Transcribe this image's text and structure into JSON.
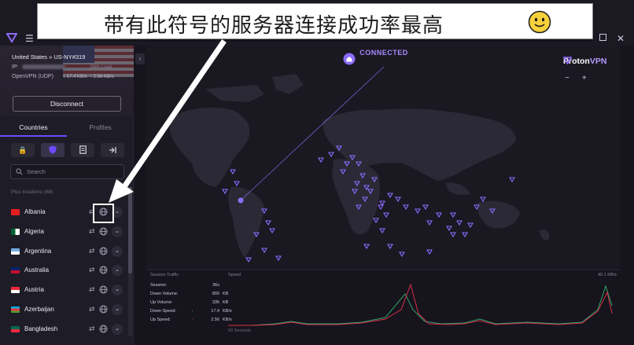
{
  "window": {
    "menu_icon": "hamburger-icon",
    "maximize_icon": "maximize-icon",
    "close_label": "✕"
  },
  "banner": {
    "text": "带有此符号的服务器连接成功率最高",
    "emoji_icon": "smiley-face-icon"
  },
  "connection": {
    "location": "United States » US-NY#319",
    "ip_label": "IP:",
    "load": "59% Load",
    "protocol": "OpenVPN (UDP)",
    "down": "↓ 17.4 KB/s",
    "up": "↑ 2.56 KB/s",
    "disconnect_label": "Disconnect"
  },
  "tabs": [
    {
      "label": "Countries",
      "active": true
    },
    {
      "label": "Profiles",
      "active": false
    }
  ],
  "filters": [
    {
      "icon": "lock-icon",
      "glyph": "🔒"
    },
    {
      "icon": "shield-icon",
      "glyph": "⛉"
    },
    {
      "icon": "document-icon",
      "glyph": "▤"
    },
    {
      "icon": "arrow-right-bar-icon",
      "glyph": "⇥"
    }
  ],
  "search": {
    "placeholder": "Search",
    "value": ""
  },
  "section_label": "Plus locations (88)",
  "countries": [
    {
      "name": "Albania",
      "colors": [
        "#e41e20"
      ]
    },
    {
      "name": "Algeria",
      "colors": [
        "#006233",
        "#ffffff"
      ]
    },
    {
      "name": "Argentina",
      "colors": [
        "#74acdf",
        "#ffffff"
      ]
    },
    {
      "name": "Australia",
      "colors": [
        "#012169",
        "#c8102e"
      ]
    },
    {
      "name": "Austria",
      "colors": [
        "#ed2939",
        "#ffffff"
      ]
    },
    {
      "name": "Azerbaijan",
      "colors": [
        "#00b5e2",
        "#ef3340",
        "#509e2f"
      ]
    },
    {
      "name": "Bangladesh",
      "colors": [
        "#006a4e",
        "#f42a41"
      ]
    }
  ],
  "map": {
    "status": "CONNECTED",
    "brand_name": "Proton",
    "brand_vpn": "VPN",
    "zoom_out": "−",
    "zoom_in": "+",
    "accent": "#6d4aff"
  },
  "session": {
    "title": "Session Traffic",
    "rows": [
      {
        "key": "Session:",
        "value": "36s",
        "unit": ""
      },
      {
        "key": "Down Volume:",
        "value": "809",
        "unit": "KB"
      },
      {
        "key": "Up Volume:",
        "value": "336",
        "unit": "KB"
      },
      {
        "key": "Down Speed:",
        "value": "17.4",
        "unit": "KB/s",
        "arrow": "↓"
      },
      {
        "key": "Up Speed:",
        "value": "2.56",
        "unit": "KB/s",
        "arrow": "↑"
      }
    ],
    "speed_label": "Speed",
    "speed_max": "49.1 KB/s",
    "speed_x": "60 Seconds"
  }
}
